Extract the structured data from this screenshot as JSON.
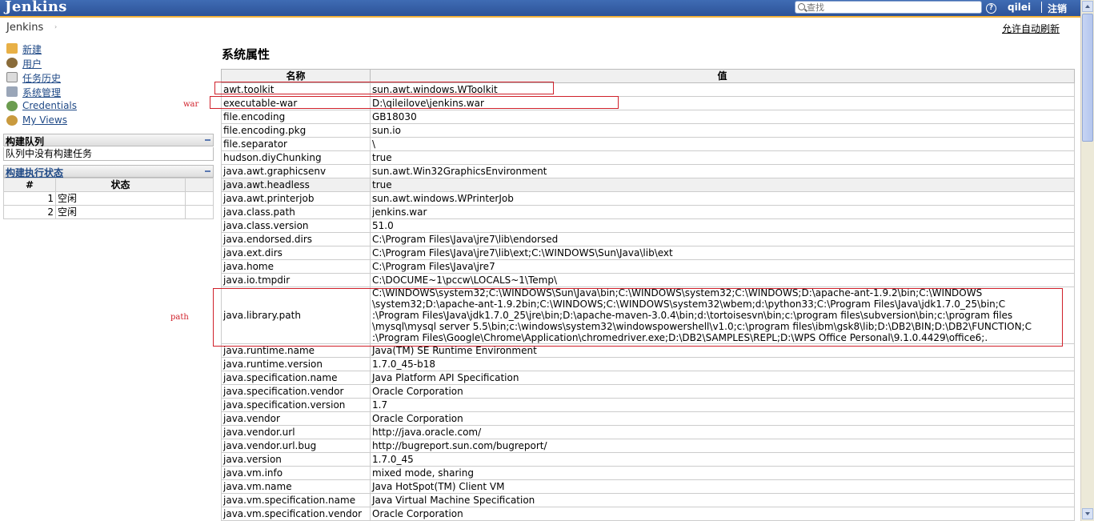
{
  "header": {
    "logo": "Jenkins",
    "search_placeholder": "查找",
    "help_icon": "?",
    "user": "qilei",
    "logout": "注销"
  },
  "breadcrumb": {
    "root": "Jenkins",
    "arrow": "›"
  },
  "auto_refresh": "允许自动刷新",
  "sidebar": {
    "tasks": [
      {
        "label": "新建",
        "icon": "new-job-icon"
      },
      {
        "label": "用户",
        "icon": "users-icon"
      },
      {
        "label": "任务历史",
        "icon": "build-history-icon"
      },
      {
        "label": "系统管理",
        "icon": "manage-jenkins-icon"
      },
      {
        "label": "Credentials",
        "icon": "credentials-icon"
      },
      {
        "label": "My Views",
        "icon": "my-views-icon"
      }
    ],
    "queue": {
      "title": "构建队列",
      "empty_text": "队列中没有构建任务"
    },
    "executors": {
      "title": "构建执行状态",
      "headers": [
        "#",
        "状态"
      ],
      "rows": [
        {
          "num": "1",
          "status": "空闲"
        },
        {
          "num": "2",
          "status": "空闲"
        }
      ]
    }
  },
  "main": {
    "title": "系统属性",
    "headers": [
      "名称",
      "值"
    ],
    "rows": [
      [
        "awt.toolkit",
        "sun.awt.windows.WToolkit"
      ],
      [
        "executable-war",
        "D:\\qileilove\\jenkins.war"
      ],
      [
        "file.encoding",
        "GB18030"
      ],
      [
        "file.encoding.pkg",
        "sun.io"
      ],
      [
        "file.separator",
        "\\"
      ],
      [
        "hudson.diyChunking",
        "true"
      ],
      [
        "java.awt.graphicsenv",
        "sun.awt.Win32GraphicsEnvironment"
      ],
      [
        "java.awt.headless",
        "true"
      ],
      [
        "java.awt.printerjob",
        "sun.awt.windows.WPrinterJob"
      ],
      [
        "java.class.path",
        "jenkins.war"
      ],
      [
        "java.class.version",
        "51.0"
      ],
      [
        "java.endorsed.dirs",
        "C:\\Program Files\\Java\\jre7\\lib\\endorsed"
      ],
      [
        "java.ext.dirs",
        "C:\\Program Files\\Java\\jre7\\lib\\ext;C:\\WINDOWS\\Sun\\Java\\lib\\ext"
      ],
      [
        "java.home",
        "C:\\Program Files\\Java\\jre7"
      ],
      [
        "java.io.tmpdir",
        "C:\\DOCUME~1\\pccw\\LOCALS~1\\Temp\\"
      ],
      [
        "java.library.path",
        "C:\\WINDOWS\\system32;C:\\WINDOWS\\Sun\\Java\\bin;C:\\WINDOWS\\system32;C:\\WINDOWS;D:\\apache-ant-1.9.2\\bin;C:\\WINDOWS\n\\system32;D:\\apache-ant-1.9.2bin;C:\\WINDOWS;C:\\WINDOWS\\system32\\wbem;d:\\python33;C:\\Program Files\\Java\\jdk1.7.0_25\\bin;C\n:\\Program Files\\Java\\jdk1.7.0_25\\jre\\bin;D:\\apache-maven-3.0.4\\bin;d:\\tortoisesvn\\bin;c:\\program files\\subversion\\bin;c:\\program files\n\\mysql\\mysql server 5.5\\bin;c:\\windows\\system32\\windowspowershell\\v1.0;c:\\program files\\ibm\\gsk8\\lib;D:\\DB2\\BIN;D:\\DB2\\FUNCTION;C\n:\\Program Files\\Google\\Chrome\\Application\\chromedriver.exe;D:\\DB2\\SAMPLES\\REPL;D:\\WPS Office Personal\\9.1.0.4429\\office6;."
      ],
      [
        "java.runtime.name",
        "Java(TM) SE Runtime Environment"
      ],
      [
        "java.runtime.version",
        "1.7.0_45-b18"
      ],
      [
        "java.specification.name",
        "Java Platform API Specification"
      ],
      [
        "java.specification.vendor",
        "Oracle Corporation"
      ],
      [
        "java.specification.version",
        "1.7"
      ],
      [
        "java.vendor",
        "Oracle Corporation"
      ],
      [
        "java.vendor.url",
        "http://java.oracle.com/"
      ],
      [
        "java.vendor.url.bug",
        "http://bugreport.sun.com/bugreport/"
      ],
      [
        "java.version",
        "1.7.0_45"
      ],
      [
        "java.vm.info",
        "mixed mode, sharing"
      ],
      [
        "java.vm.name",
        "Java HotSpot(TM) Client VM"
      ],
      [
        "java.vm.specification.name",
        "Java Virtual Machine Specification"
      ],
      [
        "java.vm.specification.vendor",
        "Oracle Corporation"
      ]
    ]
  },
  "annotations": {
    "war_label": "war",
    "path_label": "path",
    "color": "#d0202a"
  },
  "colors": {
    "header_blue": "#2d5298",
    "header_accent": "#f5b33b",
    "link": "#204a87"
  }
}
